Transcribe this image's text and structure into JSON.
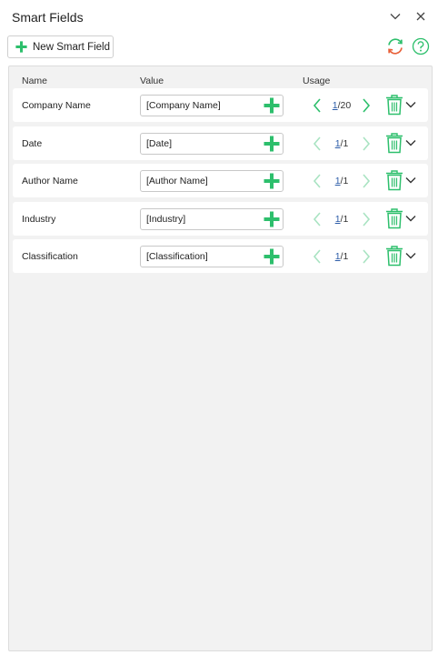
{
  "window": {
    "title": "Smart Fields"
  },
  "toolbar": {
    "new_label": "New Smart Field"
  },
  "columns": {
    "name": "Name",
    "value": "Value",
    "usage": "Usage"
  },
  "rows": [
    {
      "name": "Company Name",
      "value": "[Company Name]",
      "current": "1",
      "total": "/20"
    },
    {
      "name": "Date",
      "value": "[Date]",
      "current": "1",
      "total": "/1"
    },
    {
      "name": "Author Name",
      "value": "[Author Name]",
      "current": "1",
      "total": "/1"
    },
    {
      "name": "Industry",
      "value": "[Industry]",
      "current": "1",
      "total": "/1"
    },
    {
      "name": "Classification",
      "value": "[Classification]",
      "current": "1",
      "total": "/1"
    }
  ],
  "colors": {
    "accent_green": "#2dbf6c",
    "refresh_orange": "#e8613a",
    "panel_bg": "#f2f2f2"
  },
  "icons": [
    "chevron-down-icon",
    "close-icon",
    "plus-icon",
    "refresh-icon",
    "help-icon",
    "chevron-left-icon",
    "chevron-right-icon",
    "trash-icon"
  ]
}
